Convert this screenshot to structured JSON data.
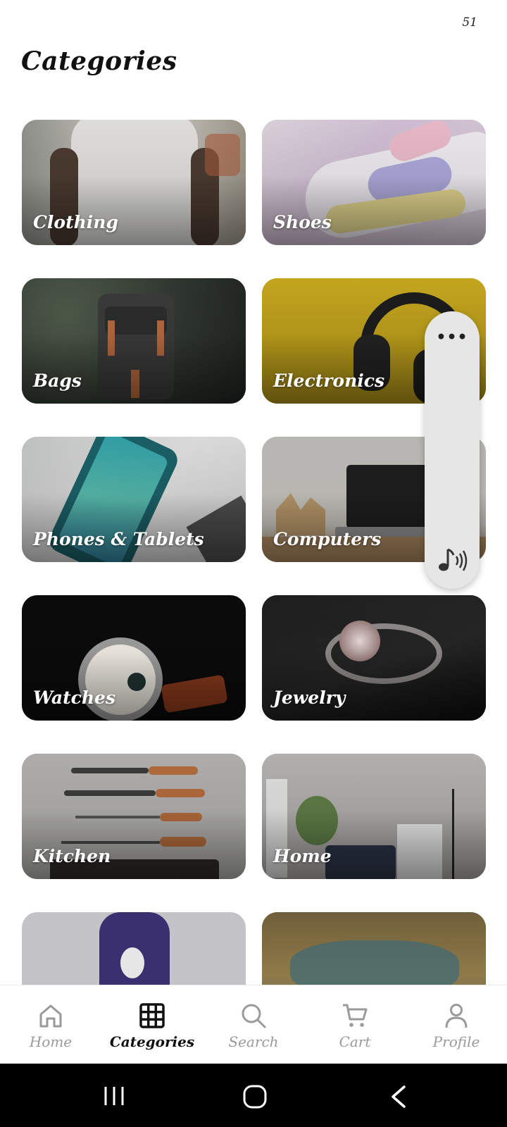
{
  "status": {
    "value": "51"
  },
  "page": {
    "title": "Categories"
  },
  "categories": [
    {
      "label": "Clothing"
    },
    {
      "label": "Shoes"
    },
    {
      "label": "Bags"
    },
    {
      "label": "Electronics"
    },
    {
      "label": "Phones & Tablets"
    },
    {
      "label": "Computers"
    },
    {
      "label": "Watches"
    },
    {
      "label": "Jewelry"
    },
    {
      "label": "Kitchen"
    },
    {
      "label": "Home"
    },
    {
      "label": ""
    },
    {
      "label": ""
    }
  ],
  "floating_panel": {
    "dots": "•••",
    "icon": "music-note-sound-icon"
  },
  "bottom_nav": {
    "items": [
      {
        "label": "Home",
        "icon": "home-icon",
        "active": false
      },
      {
        "label": "Categories",
        "icon": "grid-icon",
        "active": true
      },
      {
        "label": "Search",
        "icon": "search-icon",
        "active": false
      },
      {
        "label": "Cart",
        "icon": "cart-icon",
        "active": false
      },
      {
        "label": "Profile",
        "icon": "profile-icon",
        "active": false
      }
    ]
  },
  "system_nav": {
    "buttons": [
      "recent-apps-icon",
      "home-circle-icon",
      "back-icon"
    ]
  },
  "colors": {
    "background": "#ffffff",
    "active_nav": "#111111",
    "inactive_nav": "#9a9a9a",
    "system_bar": "#000000"
  }
}
